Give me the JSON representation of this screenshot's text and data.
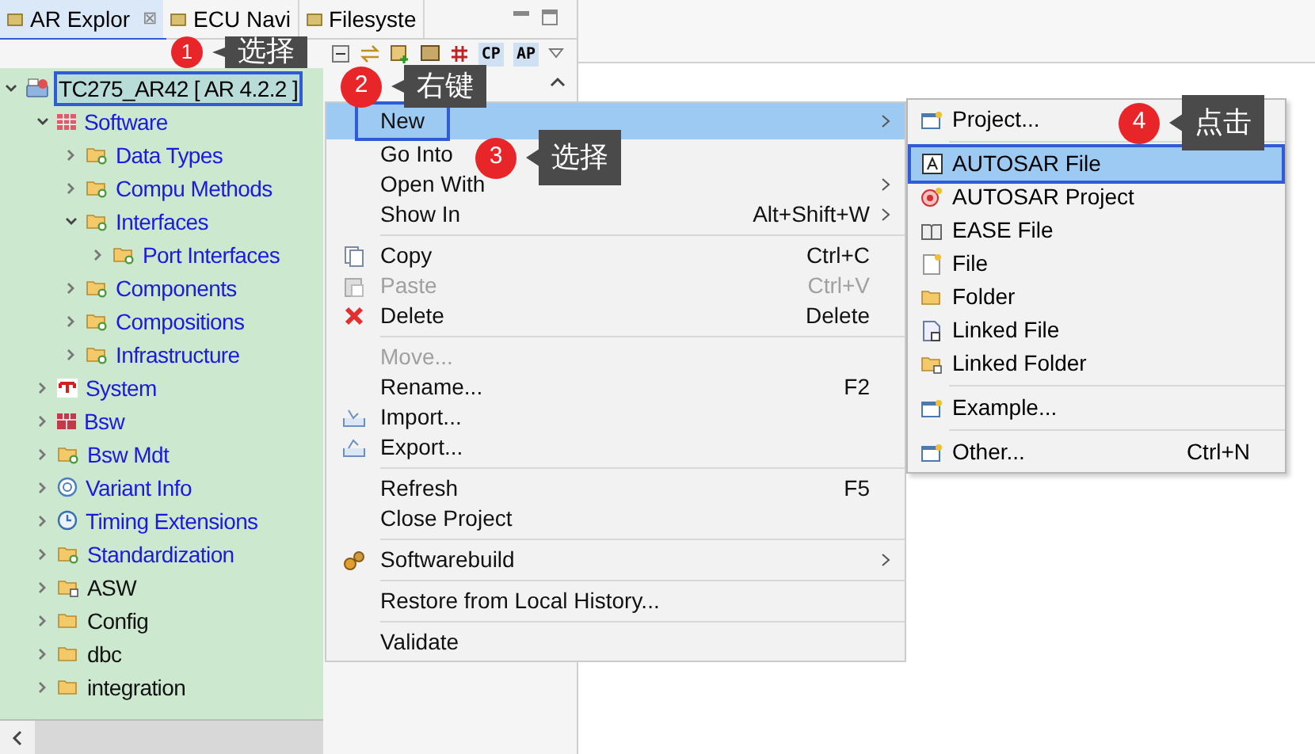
{
  "tabs": [
    {
      "label": "AR Explor",
      "close": "⊠",
      "selected": true,
      "outlined": true
    },
    {
      "label": "ECU Navi",
      "selected": false,
      "outlined": false
    },
    {
      "label": "Filesyste",
      "selected": false,
      "outlined": false
    }
  ],
  "toolbar": [
    "CP",
    "AP"
  ],
  "tree": [
    {
      "label": "TC275_AR42 [ AR 4.2.2 ]",
      "kind": "project",
      "expanded": true,
      "selected": true,
      "outlined": true,
      "children": [
        {
          "label": "Software",
          "kind": "software",
          "expanded": true,
          "selected": false,
          "children": [
            {
              "label": "Data Types",
              "kind": "package",
              "expanded": false,
              "selected": false
            },
            {
              "label": "Compu Methods",
              "kind": "package",
              "expanded": false,
              "selected": false
            },
            {
              "label": "Interfaces",
              "kind": "package",
              "expanded": true,
              "selected": false,
              "children": [
                {
                  "label": "Port Interfaces",
                  "kind": "package",
                  "expanded": false,
                  "selected": false
                }
              ]
            },
            {
              "label": "Components",
              "kind": "package",
              "expanded": false,
              "selected": false
            },
            {
              "label": "Compositions",
              "kind": "package",
              "expanded": false,
              "selected": false
            },
            {
              "label": "Infrastructure",
              "kind": "package",
              "expanded": false,
              "selected": false
            }
          ]
        },
        {
          "label": "System",
          "kind": "system",
          "expanded": false,
          "selected": false
        },
        {
          "label": "Bsw",
          "kind": "bsw",
          "expanded": false,
          "selected": false
        },
        {
          "label": "Bsw Mdt",
          "kind": "package",
          "expanded": false,
          "selected": false
        },
        {
          "label": "Variant Info",
          "kind": "variant",
          "expanded": false,
          "selected": false
        },
        {
          "label": "Timing Extensions",
          "kind": "timing",
          "expanded": false,
          "selected": false
        },
        {
          "label": "Standardization",
          "kind": "package",
          "expanded": false,
          "selected": false
        },
        {
          "label": "ASW",
          "kind": "linked-folder",
          "expanded": false,
          "selected": false
        },
        {
          "label": "Config",
          "kind": "folder",
          "expanded": false,
          "selected": false
        },
        {
          "label": "dbc",
          "kind": "folder",
          "expanded": false,
          "selected": false
        },
        {
          "label": "integration",
          "kind": "folder",
          "expanded": false,
          "selected": false
        }
      ]
    }
  ],
  "context_menu": [
    [
      {
        "label": "New",
        "kind": "plain",
        "submenu": true,
        "selected": true,
        "outlined": true,
        "disabled": false
      },
      {
        "label": "Go Into",
        "kind": "plain",
        "submenu": false,
        "selected": false,
        "outlined": false,
        "disabled": false
      },
      {
        "label": "Open With",
        "kind": "plain",
        "submenu": true,
        "selected": false,
        "outlined": false,
        "disabled": false
      },
      {
        "label": "Show In",
        "kind": "plain",
        "shortcut": "Alt+Shift+W",
        "submenu": true,
        "selected": false,
        "outlined": false,
        "disabled": false
      }
    ],
    [
      {
        "label": "Copy",
        "kind": "copy",
        "shortcut": "Ctrl+C",
        "submenu": false,
        "selected": false,
        "outlined": false,
        "disabled": false
      },
      {
        "label": "Paste",
        "kind": "paste",
        "shortcut": "Ctrl+V",
        "submenu": false,
        "selected": false,
        "outlined": false,
        "disabled": true
      },
      {
        "label": "Delete",
        "kind": "delete",
        "shortcut": "Delete",
        "submenu": false,
        "selected": false,
        "outlined": false,
        "disabled": false
      }
    ],
    [
      {
        "label": "Move...",
        "kind": "plain",
        "submenu": false,
        "selected": false,
        "outlined": false,
        "disabled": true
      },
      {
        "label": "Rename...",
        "kind": "plain",
        "shortcut": "F2",
        "submenu": false,
        "selected": false,
        "outlined": false,
        "disabled": false
      },
      {
        "label": "Import...",
        "kind": "import",
        "submenu": false,
        "selected": false,
        "outlined": false,
        "disabled": false
      },
      {
        "label": "Export...",
        "kind": "export",
        "submenu": false,
        "selected": false,
        "outlined": false,
        "disabled": false
      }
    ],
    [
      {
        "label": "Refresh",
        "kind": "plain",
        "shortcut": "F5",
        "submenu": false,
        "selected": false,
        "outlined": false,
        "disabled": false
      },
      {
        "label": "Close Project",
        "kind": "plain",
        "submenu": false,
        "selected": false,
        "outlined": false,
        "disabled": false
      }
    ],
    [
      {
        "label": "Softwarebuild",
        "kind": "softwarebuild",
        "submenu": true,
        "selected": false,
        "outlined": false,
        "disabled": false
      }
    ],
    [
      {
        "label": "Restore from Local History...",
        "kind": "plain",
        "submenu": false,
        "selected": false,
        "outlined": false,
        "disabled": false
      }
    ],
    [
      {
        "label": "Validate",
        "kind": "plain",
        "submenu": false,
        "selected": false,
        "outlined": false,
        "disabled": false
      }
    ]
  ],
  "new_submenu": [
    [
      {
        "label": "Project...",
        "kind": "wizard",
        "selected": false,
        "outlined": false
      }
    ],
    [
      {
        "label": "AUTOSAR File",
        "kind": "autosar-file",
        "selected": true,
        "outlined": true
      },
      {
        "label": "AUTOSAR Project",
        "kind": "autosar-project",
        "selected": false,
        "outlined": false
      },
      {
        "label": "EASE File",
        "kind": "ease",
        "selected": false,
        "outlined": false
      },
      {
        "label": "File",
        "kind": "file",
        "selected": false,
        "outlined": false
      },
      {
        "label": "Folder",
        "kind": "folder",
        "selected": false,
        "outlined": false
      },
      {
        "label": "Linked File",
        "kind": "linked-file",
        "selected": false,
        "outlined": false
      },
      {
        "label": "Linked Folder",
        "kind": "linked-folder",
        "selected": false,
        "outlined": false
      }
    ],
    [
      {
        "label": "Example...",
        "kind": "wizard",
        "selected": false,
        "outlined": false
      }
    ],
    [
      {
        "label": "Other...",
        "kind": "wizard",
        "shortcut": "Ctrl+N",
        "selected": false,
        "outlined": false
      }
    ]
  ],
  "callouts": [
    {
      "number": "1",
      "text": "选择"
    },
    {
      "number": "2",
      "text": "右键"
    },
    {
      "number": "3",
      "text": "选择"
    },
    {
      "number": "4",
      "text": "点击"
    }
  ]
}
